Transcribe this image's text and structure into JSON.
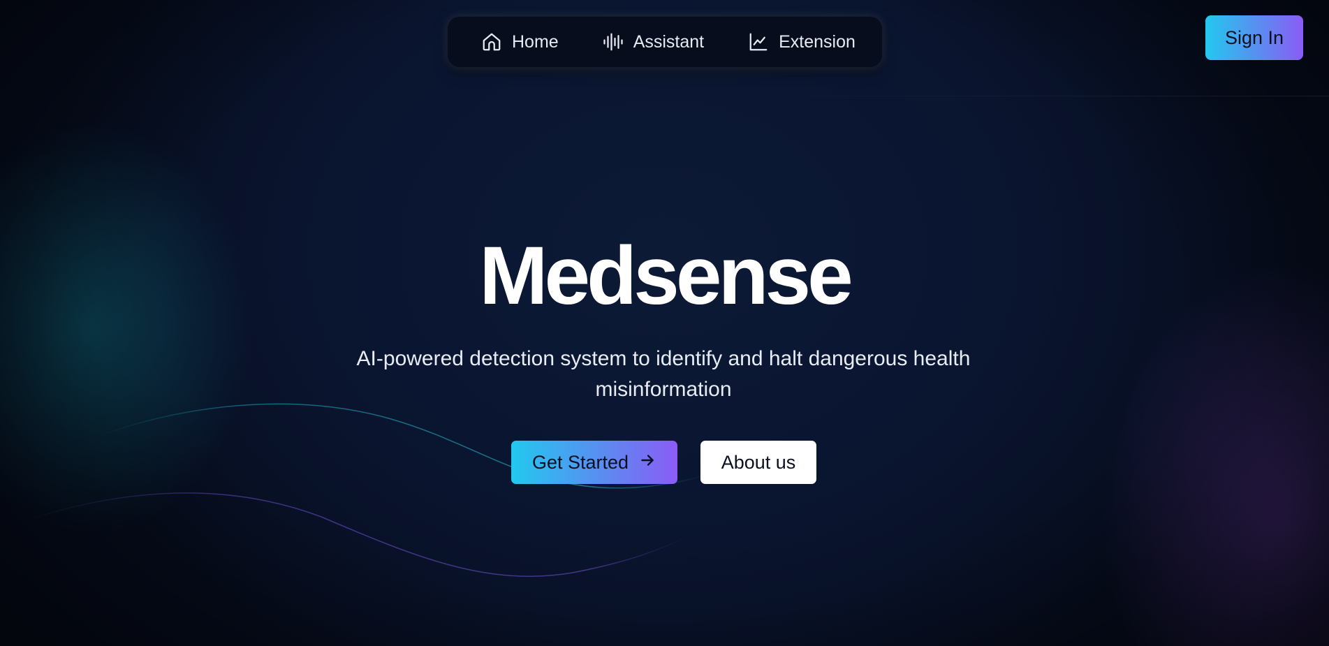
{
  "nav": {
    "items": [
      {
        "label": "Home",
        "icon": "home-icon"
      },
      {
        "label": "Assistant",
        "icon": "audio-waveform-icon"
      },
      {
        "label": "Extension",
        "icon": "line-chart-icon"
      }
    ]
  },
  "header": {
    "signin_label": "Sign In"
  },
  "hero": {
    "title": "Medsense",
    "subtitle": "AI-powered detection system to identify and halt dangerous health misinformation",
    "primary_label": "Get Started",
    "primary_icon": "arrow-right-icon",
    "secondary_label": "About us"
  },
  "colors": {
    "background": "#0a1328",
    "accent_gradient_start": "#22c9ef",
    "accent_gradient_end": "#8a5cf6",
    "teal_glow": "#0d5f6e",
    "purple_glow": "#522e82"
  }
}
